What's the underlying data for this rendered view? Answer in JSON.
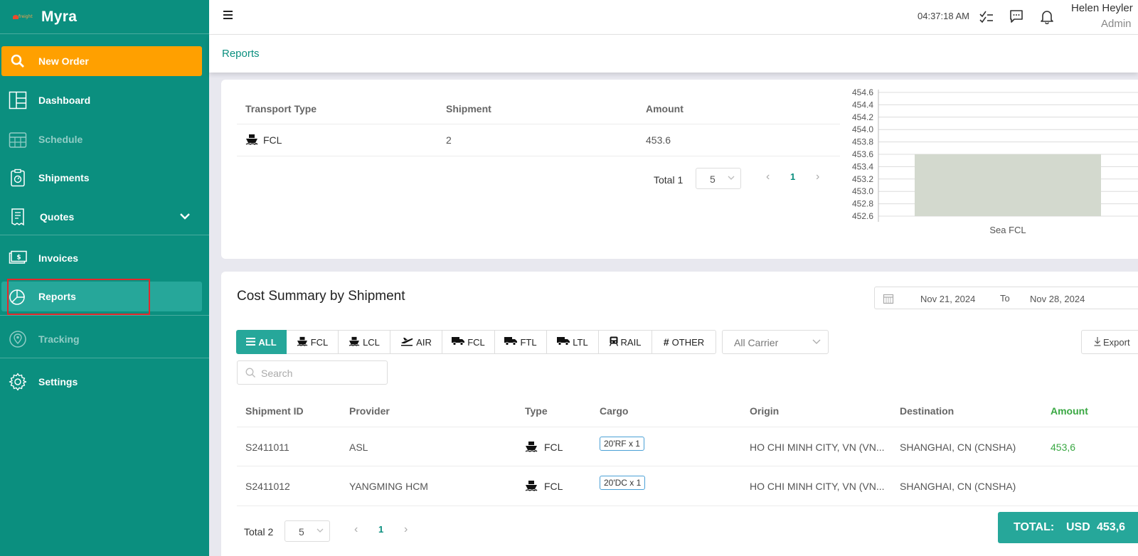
{
  "app": {
    "name": "Myra",
    "logo_text": "freight"
  },
  "sidebar": {
    "new_order": "New Order",
    "items": [
      {
        "label": "Dashboard"
      },
      {
        "label": "Schedule"
      },
      {
        "label": "Shipments"
      },
      {
        "label": "Quotes"
      },
      {
        "label": "Invoices"
      },
      {
        "label": "Reports"
      },
      {
        "label": "Tracking"
      },
      {
        "label": "Settings"
      }
    ]
  },
  "header": {
    "time": "04:37:18 AM",
    "user_name": "Helen Heyler",
    "user_role": "Admin"
  },
  "breadcrumb": "Reports",
  "transport_table": {
    "headers": [
      "Transport Type",
      "Shipment",
      "Amount"
    ],
    "rows": [
      {
        "type": "FCL",
        "shipment": "2",
        "amount": "453.6"
      }
    ],
    "total": "Total 1",
    "page_size": "5",
    "page": "1"
  },
  "chart_data": {
    "type": "bar",
    "categories": [
      "Sea FCL"
    ],
    "values": [
      453.6
    ],
    "ylim": [
      452.6,
      454.6
    ],
    "yticks": [
      "454.6",
      "454.4",
      "454.2",
      "454.0",
      "453.8",
      "453.6",
      "453.4",
      "453.2",
      "453.0",
      "452.8",
      "452.6"
    ],
    "bar_color": "#d3d9ce",
    "grid": true
  },
  "cost_summary": {
    "title": "Cost Summary by Shipment",
    "date_from": "Nov 21, 2024",
    "date_to_label": "To",
    "date_to": "Nov 28, 2024",
    "filters": [
      "ALL",
      "FCL",
      "LCL",
      "AIR",
      "FCL",
      "FTL",
      "LTL",
      "RAIL",
      "OTHER"
    ],
    "carrier_placeholder": "All Carrier",
    "export_label": "Export",
    "search_placeholder": "Search",
    "headers": [
      "Shipment ID",
      "Provider",
      "Type",
      "Cargo",
      "Origin",
      "Destination",
      "Amount"
    ],
    "rows": [
      {
        "id": "S2411011",
        "provider": "ASL",
        "type": "FCL",
        "cargo": "20'RF x 1",
        "origin": "HO CHI MINH CITY, VN (VN...",
        "destination": "SHANGHAI, CN (CNSHA)",
        "amount": "453,6"
      },
      {
        "id": "S2411012",
        "provider": "YANGMING HCM",
        "type": "FCL",
        "cargo": "20'DC x 1",
        "origin": "HO CHI MINH CITY, VN (VN...",
        "destination": "SHANGHAI, CN (CNSHA)",
        "amount": ""
      }
    ],
    "total": "Total 2",
    "page_size": "5",
    "page": "1",
    "grand_total_label": "TOTAL:",
    "grand_total_currency": "USD",
    "grand_total_value": "453,6"
  },
  "colors": {
    "brand": "#0b8f7f",
    "accent": "#ffa000",
    "active": "#26a79a",
    "amount": "#3aa843"
  }
}
